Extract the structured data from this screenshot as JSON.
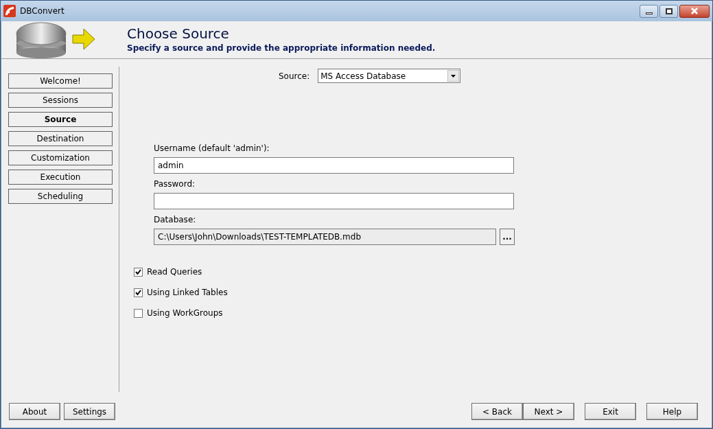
{
  "window": {
    "title": "DBConvert"
  },
  "header": {
    "title": "Choose Source",
    "subtitle": "Specify a source and provide the appropriate information needed."
  },
  "sidebar": {
    "items": [
      {
        "label": "Welcome!",
        "selected": false
      },
      {
        "label": "Sessions",
        "selected": false
      },
      {
        "label": "Source",
        "selected": true
      },
      {
        "label": "Destination",
        "selected": false
      },
      {
        "label": "Customization",
        "selected": false
      },
      {
        "label": "Execution",
        "selected": false
      },
      {
        "label": "Scheduling",
        "selected": false
      }
    ]
  },
  "source": {
    "label": "Source:",
    "value": "MS Access Database"
  },
  "fields": [
    {
      "label": "Username (default 'admin'):",
      "value": "admin",
      "kind": "text"
    },
    {
      "label": "Password:",
      "kind": "text"
    },
    {
      "label": "Database:",
      "value": "C:\\Users\\John\\Downloads\\TEST-TEMPLATEDB.mdb",
      "kind": "file",
      "button": "..."
    }
  ],
  "options": [
    {
      "label": "Read Queries",
      "checked": true
    },
    {
      "label": "Using Linked Tables",
      "checked": true
    },
    {
      "label": "Using WorkGroups",
      "checked": false
    }
  ],
  "footer": {
    "left": [
      "About",
      "Settings"
    ],
    "nav": [
      "< Back",
      "Next >"
    ],
    "right": [
      "Exit",
      "Help"
    ]
  }
}
